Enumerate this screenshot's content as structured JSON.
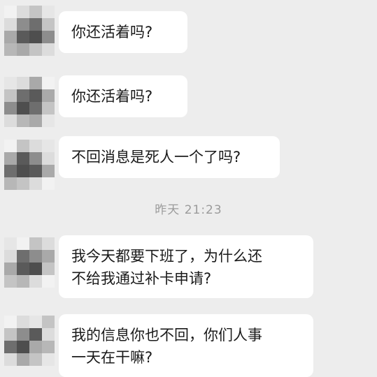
{
  "messages": [
    {
      "lines": [
        "你还活着吗?"
      ]
    },
    {
      "lines": [
        "你还活着吗?"
      ]
    },
    {
      "lines": [
        "不回消息是死人一个了吗?"
      ]
    },
    {
      "lines": [
        "我今天都要下班了，为什么还",
        "不给我通过补卡申请?"
      ]
    },
    {
      "lines": [
        "我的信息你也不回，你们人事",
        "一天在干嘛?"
      ]
    }
  ],
  "timestamp": "昨天  21:23",
  "colors": {
    "background": "#ededed",
    "bubble": "#ffffff",
    "text": "#1a1a1a",
    "timestamp": "#9b9b9b"
  }
}
